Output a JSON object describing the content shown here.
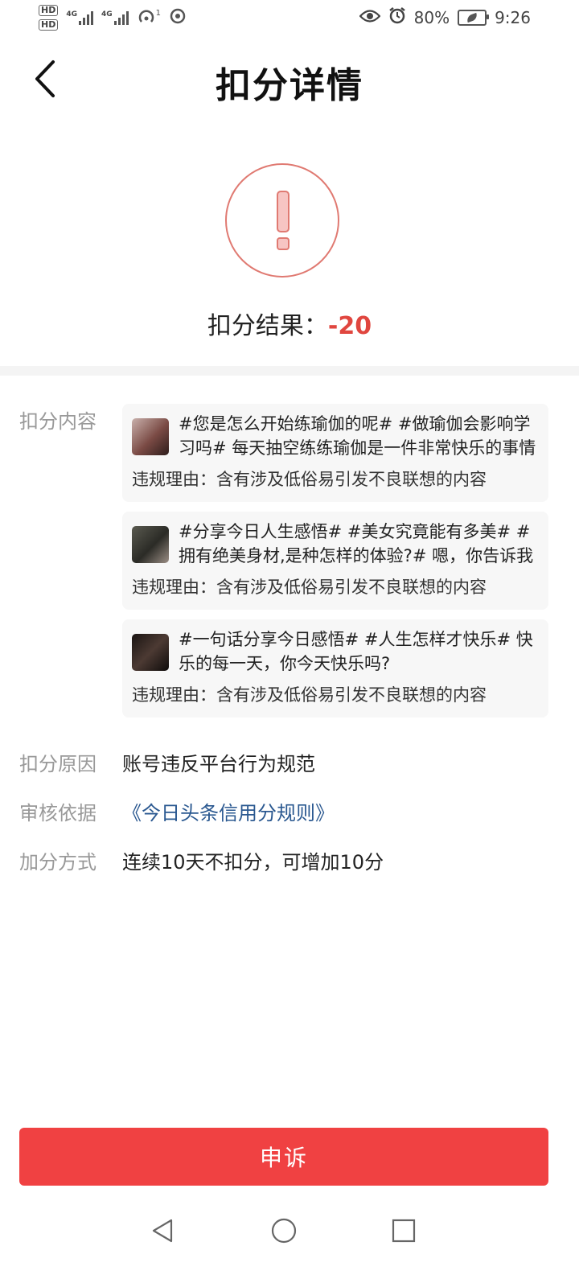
{
  "status_bar": {
    "hd_badges": [
      "HD",
      "HD"
    ],
    "network_labels": [
      "4G",
      "4G"
    ],
    "hotspot_superscript": "1",
    "battery_percent": "80%",
    "time": "9:26",
    "icons": [
      "eye-icon",
      "alarm-icon",
      "battery-icon"
    ]
  },
  "header": {
    "title": "扣分详情",
    "back_icon": "chevron-left-icon"
  },
  "result": {
    "label": "扣分结果：",
    "score": "-20",
    "icon": "exclamation-icon",
    "accent_color": "#e0463f"
  },
  "details": {
    "content_label": "扣分内容",
    "posts": [
      {
        "text": "#您是怎么开始练瑜伽的呢# #做瑜伽会影响学习吗# 每天抽空练练瑜伽是一件非常快乐的事情",
        "reason": "违规理由：含有涉及低俗易引发不良联想的内容"
      },
      {
        "text": "#分享今日人生感悟# #美女究竟能有多美# #拥有绝美身材,是种怎样的体验?# 嗯，你告诉我",
        "reason": "违规理由：含有涉及低俗易引发不良联想的内容"
      },
      {
        "text": "#一句话分享今日感悟# #人生怎样才快乐# 快乐的每一天，你今天快乐吗?",
        "reason": "违规理由：含有涉及低俗易引发不良联想的内容"
      }
    ],
    "rows": [
      {
        "key": "扣分原因",
        "value": "账号违反平台行为规范"
      },
      {
        "key": "审核依据",
        "value": "《今日头条信用分规则》"
      },
      {
        "key": "加分方式",
        "value": "连续10天不扣分，可增加10分"
      }
    ],
    "link_color": "#2a5890"
  },
  "appeal_button": {
    "label": "申诉",
    "color": "#f04142"
  },
  "nav_bar": {
    "icons": [
      "back-triangle-icon",
      "home-circle-icon",
      "recents-square-icon"
    ]
  }
}
